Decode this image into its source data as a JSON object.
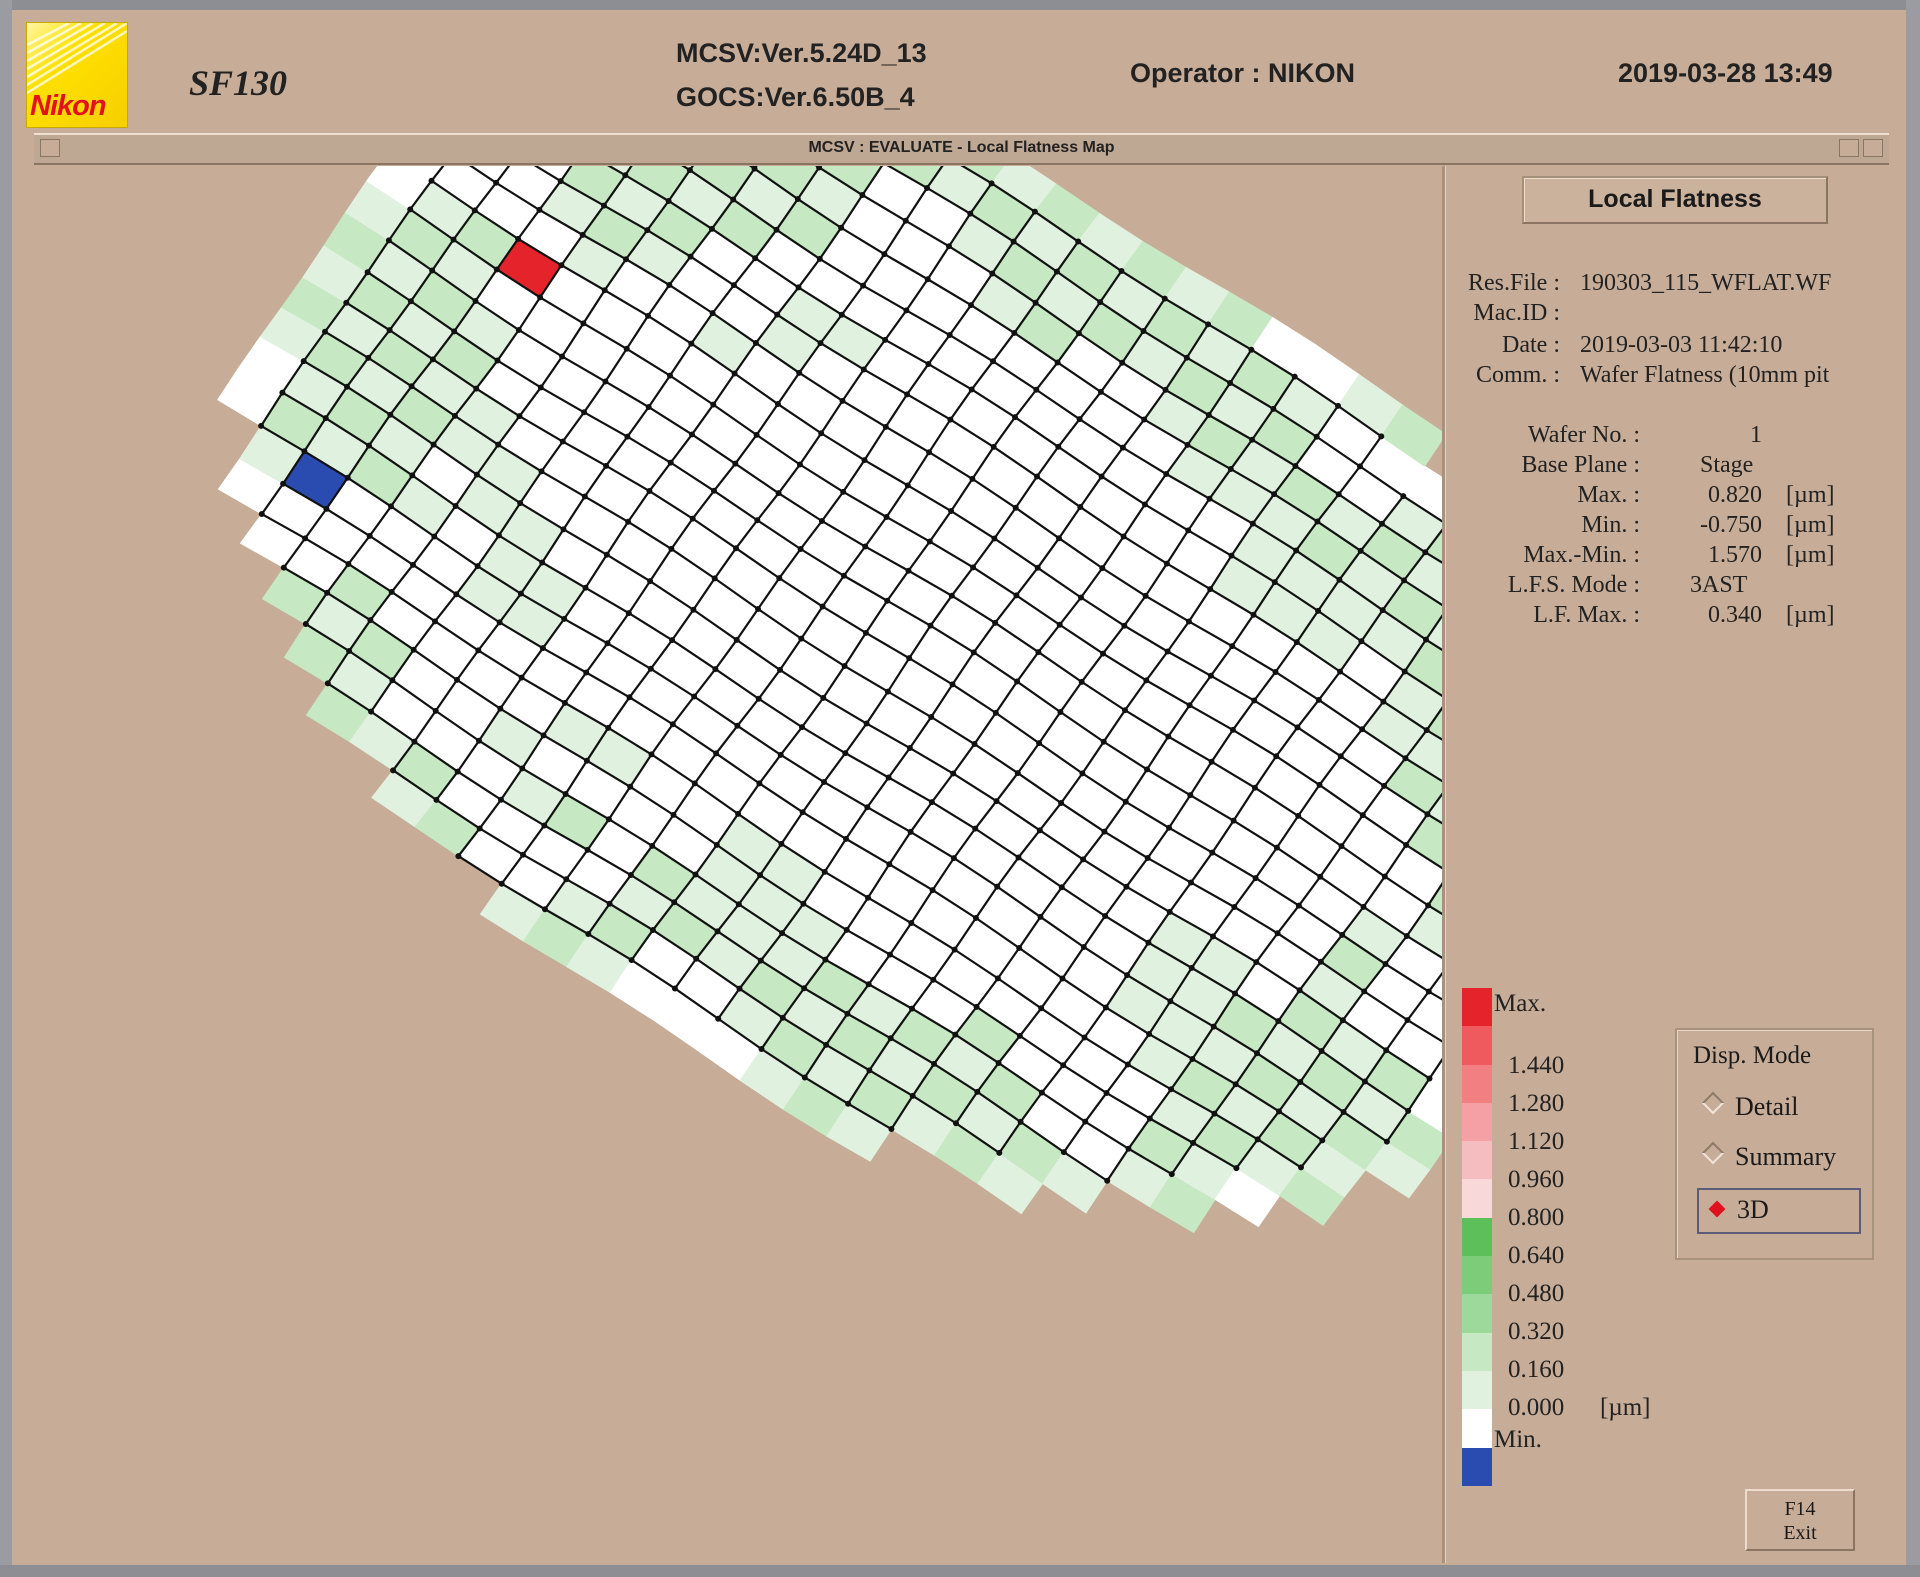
{
  "header": {
    "brand": "Nikon",
    "model": "SF130",
    "mcsv_version": "MCSV:Ver.5.24D_13",
    "gocs_version": "GOCS:Ver.6.50B_4",
    "operator": "Operator : NIKON",
    "datetime": "2019-03-28 13:49"
  },
  "window": {
    "title": "MCSV : EVALUATE - Local Flatness Map"
  },
  "panel": {
    "title": "Local Flatness",
    "file_info": [
      {
        "label": "Res.File :",
        "value": "190303_115_WFLAT.WF"
      },
      {
        "label": "Mac.ID :",
        "value": ""
      },
      {
        "label": "Date :",
        "value": "2019-03-03 11:42:10"
      },
      {
        "label": "Comm. :",
        "value": "Wafer Flatness (10mm pit"
      }
    ],
    "stats": [
      {
        "label": "Wafer No. :",
        "value": "1",
        "unit": ""
      },
      {
        "label": "Base Plane :",
        "value": "Stage",
        "unit": ""
      },
      {
        "label": "Max. :",
        "value": "0.820",
        "unit": "[µm]"
      },
      {
        "label": "Min. :",
        "value": "-0.750",
        "unit": "[µm]"
      },
      {
        "label": "Max.-Min. :",
        "value": "1.570",
        "unit": "[µm]"
      },
      {
        "label": "L.F.S. Mode :",
        "value": "3AST",
        "unit": ""
      },
      {
        "label": "L.F. Max. :",
        "value": "0.340",
        "unit": "[µm]"
      }
    ]
  },
  "legend": {
    "max_label": "Max.",
    "min_label": "Min.",
    "unit": "[µm]",
    "ticks": [
      "1.440",
      "1.280",
      "1.120",
      "0.960",
      "0.800",
      "0.640",
      "0.480",
      "0.320",
      "0.160",
      "0.000"
    ],
    "colors": [
      "#e4242a",
      "#ee5a5e",
      "#f27f82",
      "#f4a0a4",
      "#f6bdc0",
      "#f8d8d8",
      "#5cbf5a",
      "#7ccc79",
      "#9dd99a",
      "#c6e8c3",
      "#e1f1df",
      "#ffffff",
      "#2a4cb0"
    ]
  },
  "disp_mode": {
    "title": "Disp. Mode",
    "options": [
      {
        "label": "Detail",
        "selected": false
      },
      {
        "label": "Summary",
        "selected": false
      },
      {
        "label": "3D",
        "selected": true
      }
    ]
  },
  "exit_button": {
    "line1": "F14",
    "line2": "Exit"
  },
  "wafer_map": {
    "grid_rows": 24,
    "grid_cols": 27,
    "mode": "3D"
  }
}
